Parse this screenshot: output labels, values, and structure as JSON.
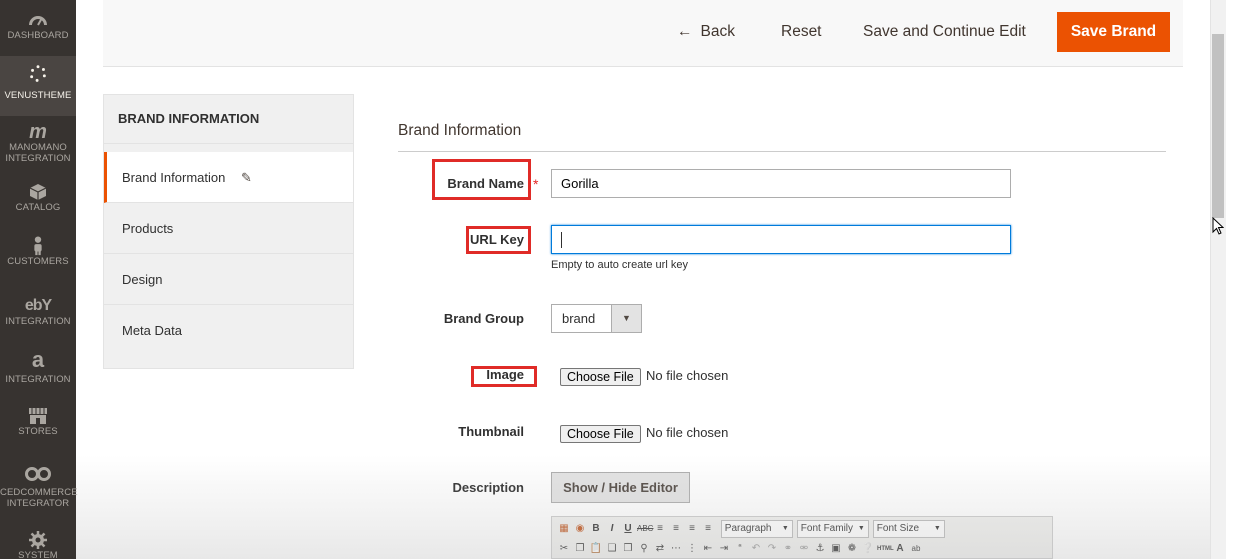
{
  "sidebar": {
    "items": [
      {
        "label": "DASHBOARD",
        "icon": "dashboard-icon"
      },
      {
        "label": "VENUSTHEME",
        "icon": "venustheme-icon",
        "active": true
      },
      {
        "label": "MANOMANO INTEGRATION",
        "icon": "manomano-icon"
      },
      {
        "label": "CATALOG",
        "icon": "catalog-icon"
      },
      {
        "label": "CUSTOMERS",
        "icon": "customers-icon"
      },
      {
        "label": "INTEGRATION",
        "icon": "ebay-icon"
      },
      {
        "label": "INTEGRATION",
        "icon": "amazon-icon"
      },
      {
        "label": "STORES",
        "icon": "stores-icon"
      },
      {
        "label": "CEDCOMMERCE INTEGRATOR",
        "icon": "cedcommerce-icon"
      },
      {
        "label": "SYSTEM",
        "icon": "gear-icon"
      }
    ]
  },
  "actions": {
    "back": "Back",
    "reset": "Reset",
    "save_continue": "Save and Continue Edit",
    "save": "Save Brand"
  },
  "tabs": {
    "title": "BRAND INFORMATION",
    "items": [
      "Brand Information",
      "Products",
      "Design",
      "Meta Data"
    ]
  },
  "form": {
    "section_title": "Brand Information",
    "brand_name": {
      "label": "Brand Name",
      "value": "Gorilla",
      "required": "*"
    },
    "url_key": {
      "label": "URL Key",
      "value": "",
      "note": "Empty to auto create url key"
    },
    "brand_group": {
      "label": "Brand Group",
      "value": "brand"
    },
    "image": {
      "label": "Image",
      "button": "Choose File",
      "status": "No file chosen"
    },
    "thumbnail": {
      "label": "Thumbnail",
      "button": "Choose File",
      "status": "No file chosen"
    },
    "description": {
      "label": "Description",
      "button": "Show / Hide Editor"
    },
    "editor": {
      "paragraph": "Paragraph",
      "font_family": "Font Family",
      "font_size": "Font Size"
    }
  },
  "colors": {
    "accent": "#eb5202",
    "highlight": "#e02b27",
    "sidebar": "#373330"
  }
}
